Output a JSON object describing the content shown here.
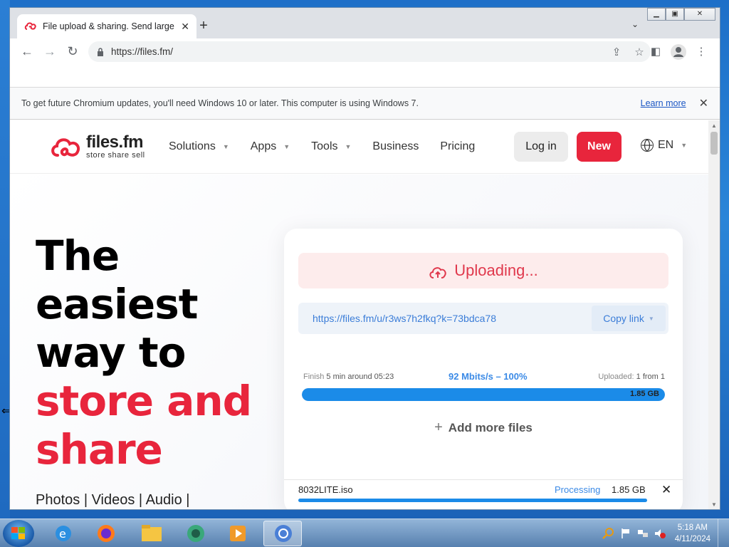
{
  "browser": {
    "tab_title": "File upload & sharing. Send large",
    "url": "https://files.fm/"
  },
  "infobar": {
    "message": "To get future Chromium updates, you'll need Windows 10 or later. This computer is using Windows 7.",
    "learn_more": "Learn more"
  },
  "site": {
    "logo_name": "files.fm",
    "logo_tagline": "store  share  sell",
    "nav": [
      {
        "label": "Solutions"
      },
      {
        "label": "Apps"
      },
      {
        "label": "Tools"
      },
      {
        "label": "Business"
      },
      {
        "label": "Pricing"
      }
    ],
    "login_label": "Log in",
    "new_label": "New",
    "lang": "EN",
    "brand_color": "#e8253c"
  },
  "hero": {
    "line1": "The",
    "line2": "easiest",
    "line3": "way to",
    "line4": "store and",
    "line5": "share",
    "sub": "Photos  |  Videos  |  Audio  |"
  },
  "upload": {
    "status": "Uploading...",
    "share_url": "https://files.fm/u/r3ws7h2fkq?k=73bdca78",
    "copy_label": "Copy link",
    "finish_label": "Finish",
    "finish_value": "5 min around 05:23",
    "speed": "92 Mbits/s – 100%",
    "uploaded_label": "Uploaded:",
    "uploaded_value": "1 from 1",
    "total_size": "1.85 GB",
    "progress": 1.0,
    "add_more": "Add more files",
    "file": {
      "name": "8032LITE.iso",
      "status": "Processing",
      "size": "1.85 GB"
    }
  },
  "taskbar": {
    "time": "5:18 AM",
    "date": "4/11/2024",
    "apps": [
      "internet-explorer",
      "firefox",
      "file-explorer",
      "app-green",
      "media-player",
      "chromium"
    ]
  }
}
